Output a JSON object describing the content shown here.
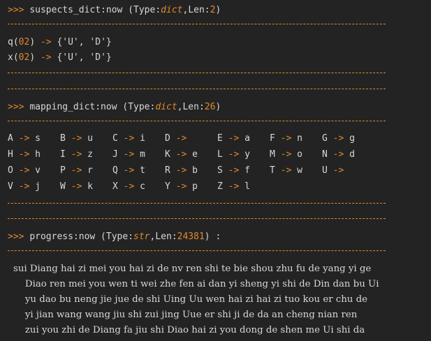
{
  "prompt": ">>>",
  "colors": {
    "background": "#232323",
    "accent": "#e08a2c",
    "text": "#d8d8d8"
  },
  "suspects": {
    "name": "suspects_dict:now",
    "type_label": "Type:",
    "type": "dict",
    "len_label": "Len:",
    "len": "2",
    "entries": [
      {
        "key": "q",
        "arg": "02",
        "arrow": "->",
        "value": "{'U', 'D'}"
      },
      {
        "key": "x",
        "arg": "02",
        "arrow": "->",
        "value": "{'U', 'D'}"
      }
    ]
  },
  "mapping": {
    "name": "mapping_dict:now",
    "type_label": "Type:",
    "type": "dict",
    "len_label": "Len:",
    "len": "26",
    "rows": [
      [
        [
          "A",
          "s"
        ],
        [
          "B",
          "u"
        ],
        [
          "C",
          "i"
        ],
        [
          "D",
          ""
        ],
        [
          "E",
          "a"
        ],
        [
          "F",
          "n"
        ],
        [
          "G",
          "g"
        ]
      ],
      [
        [
          "H",
          "h"
        ],
        [
          "I",
          "z"
        ],
        [
          "J",
          "m"
        ],
        [
          "K",
          "e"
        ],
        [
          "L",
          "y"
        ],
        [
          "M",
          "o"
        ],
        [
          "N",
          "d"
        ]
      ],
      [
        [
          "O",
          "v"
        ],
        [
          "P",
          "r"
        ],
        [
          "Q",
          "t"
        ],
        [
          "R",
          "b"
        ],
        [
          "S",
          "f"
        ],
        [
          "T",
          "w"
        ],
        [
          "U",
          ""
        ]
      ],
      [
        [
          "V",
          "j"
        ],
        [
          "W",
          "k"
        ],
        [
          "X",
          "c"
        ],
        [
          "Y",
          "p"
        ],
        [
          "Z",
          "l"
        ]
      ]
    ],
    "arrow": "->"
  },
  "progress": {
    "name": "progress:now",
    "type_label": "Type:",
    "type": "str",
    "len_label": "Len:",
    "len": "24381",
    "suffix": ") :",
    "lines": [
      "sui Diang hai zi mei you hai zi de nv ren shi te bie shou zhu fu de yang yi ge",
      "    Diao ren mei you wen ti wei zhe fen ai dan yi sheng yi shi de Din dan bu Ui",
      "    yu dao bu neng jie jue de shi Uing Uu wen hai zi hai zi tuo kou er chu de",
      "    yi jian wang wang jiu shi zui jing Uue er shi ji de da an cheng nian ren",
      "    zui you zhi de Diang fa jiu shi Diao hai zi you dong de shen me Ui shi da"
    ]
  }
}
